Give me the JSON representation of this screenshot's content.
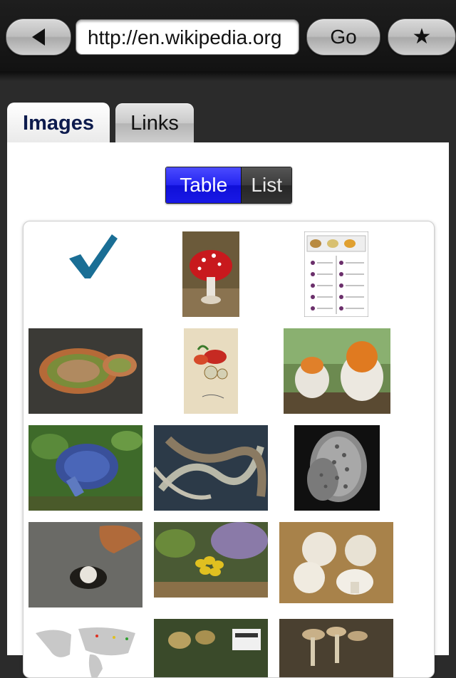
{
  "toolbar": {
    "url": "http://en.wikipedia.org",
    "go_label": "Go",
    "back_icon": "back-arrow-icon",
    "bookmark_icon": "star-icon"
  },
  "tabs": [
    {
      "label": "Images",
      "selected": true
    },
    {
      "label": "Links",
      "selected": false
    }
  ],
  "view_toggle": {
    "options": [
      "Table",
      "List"
    ],
    "selected": "Table"
  },
  "colors": {
    "accent": "#2020f0",
    "background": "#2b2b2b",
    "check": "#1a6e95"
  },
  "gallery": {
    "selected_icon": "checkmark-icon"
  }
}
